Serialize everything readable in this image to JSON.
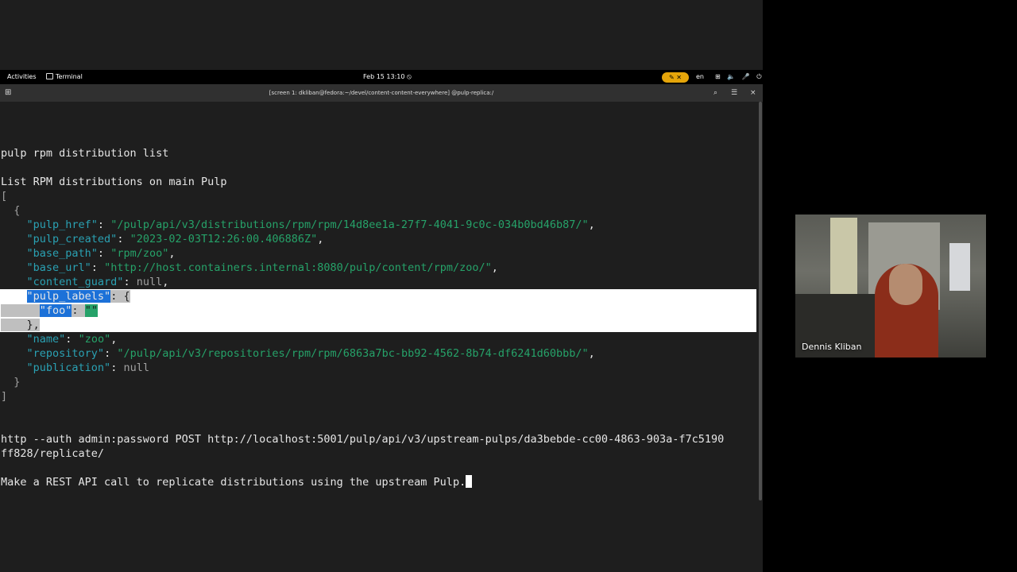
{
  "topbar": {
    "activities": "Activities",
    "app_name": "Terminal",
    "clock": "Feb 15  13:10",
    "dnd_icon": "⦸",
    "indicator": "✎ ✕",
    "language": "en",
    "tray_icons": "⊞ 🔈 🎤 ⏻"
  },
  "titlebar": {
    "new_tab": "⊞",
    "title": "[screen 1: dkliban@fedora:~/devel/content-content-everywhere] @pulp-replica:/",
    "search": "⌕",
    "menu": "☰",
    "close": "×"
  },
  "terminal": {
    "cmd1": "pulp rpm distribution list",
    "desc1": "List RPM distributions on main Pulp",
    "open_bracket": "[",
    "open_brace": "  {",
    "fields": [
      {
        "key": "\"pulp_href\"",
        "value": "\"/pulp/api/v3/distributions/rpm/rpm/14d8ee1a-27f7-4041-9c0c-034b0bd46b87/\"",
        "suffix": ","
      },
      {
        "key": "\"pulp_created\"",
        "value": "\"2023-02-03T12:26:00.406886Z\"",
        "suffix": ","
      },
      {
        "key": "\"base_path\"",
        "value": "\"rpm/zoo\"",
        "suffix": ","
      },
      {
        "key": "\"base_url\"",
        "value": "\"http://host.containers.internal:8080/pulp/content/rpm/zoo/\"",
        "suffix": ","
      },
      {
        "key": "\"content_guard\"",
        "value": "null",
        "suffix": ","
      }
    ],
    "labels_key": "\"pulp_labels\"",
    "labels_open": ": {",
    "foo_key": "\"foo\"",
    "foo_value": "\"\"",
    "labels_close": "},",
    "fields2": [
      {
        "key": "\"name\"",
        "value": "\"zoo\"",
        "suffix": ","
      },
      {
        "key": "\"repository\"",
        "value": "\"/pulp/api/v3/repositories/rpm/rpm/6863a7bc-bb92-4562-8b74-df6241d60bbb/\"",
        "suffix": ","
      },
      {
        "key": "\"publication\"",
        "value": "null",
        "suffix": ""
      }
    ],
    "close_brace": "  }",
    "close_bracket": "]",
    "cmd2_line1": "http --auth admin:password POST http://localhost:5001/pulp/api/v3/upstream-pulps/da3bebde-cc00-4863-903a-f7c5190",
    "cmd2_line2": "ff828/replicate/",
    "desc2": "Make a REST API call to replicate distributions using the upstream Pulp."
  },
  "webcam": {
    "participant_name": "Dennis Kliban"
  }
}
